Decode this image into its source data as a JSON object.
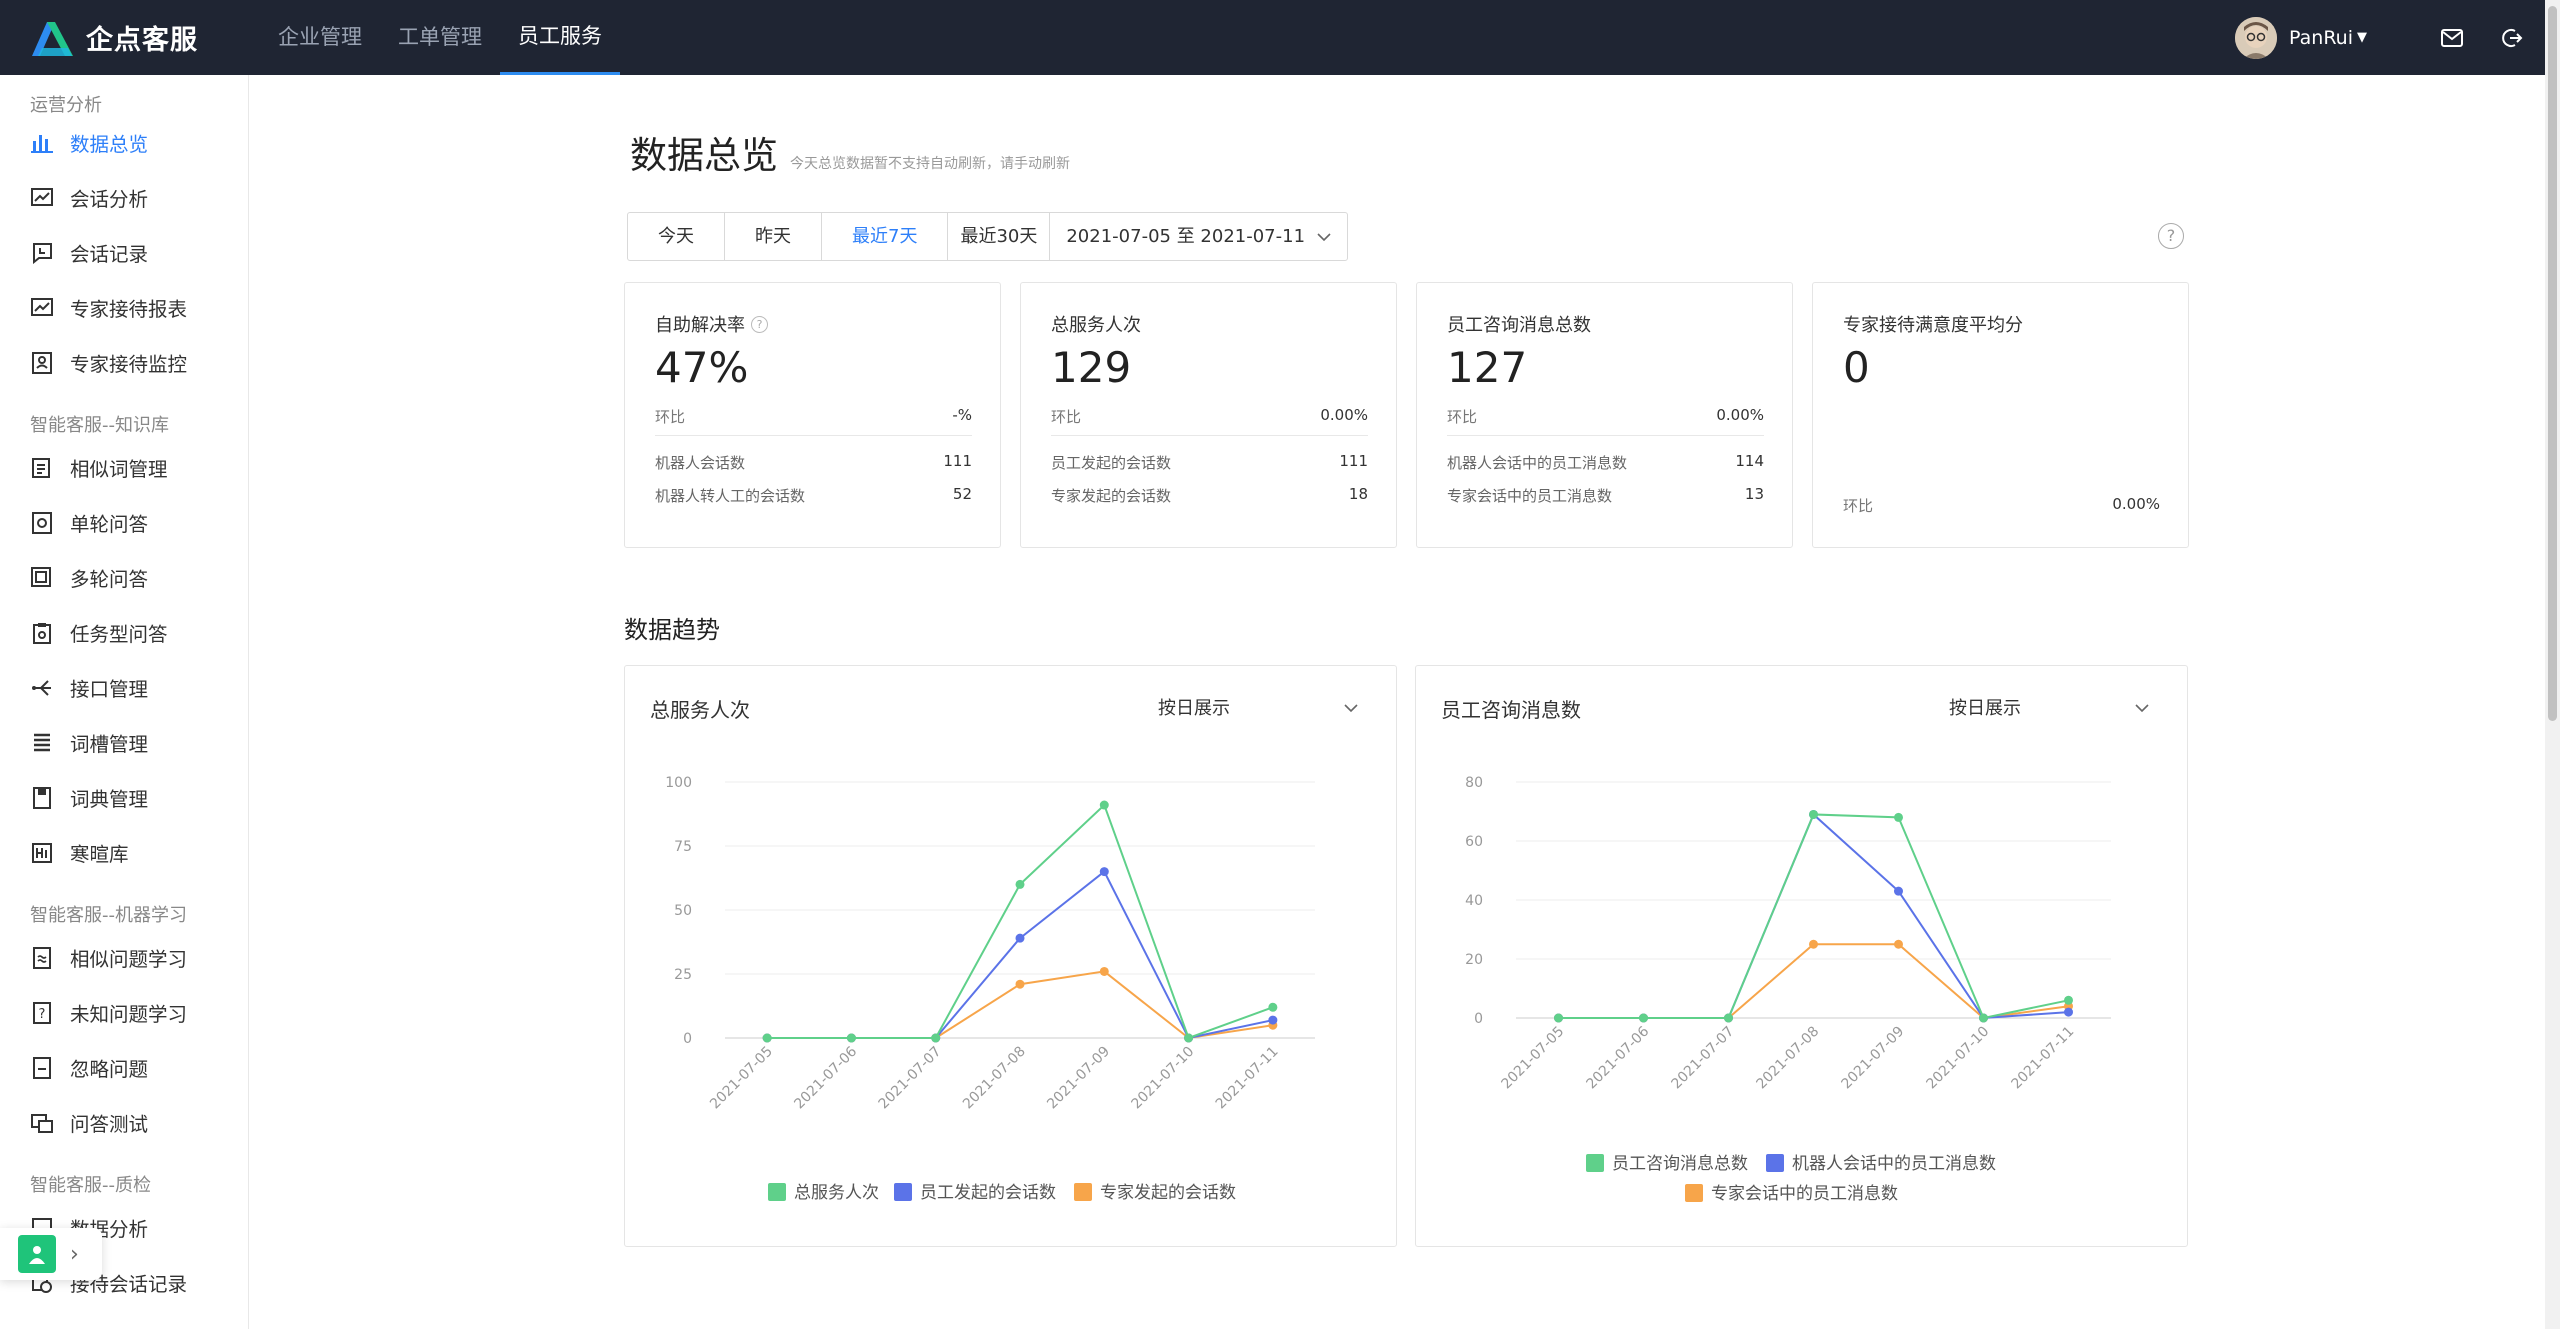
{
  "app": {
    "name": "企点客服"
  },
  "topnav": [
    {
      "label": "企业管理",
      "active": false
    },
    {
      "label": "工单管理",
      "active": false
    },
    {
      "label": "员工服务",
      "active": true
    }
  ],
  "user": {
    "name": "PanRui"
  },
  "sidebar": {
    "groups": [
      {
        "title": "运营分析",
        "items": [
          {
            "label": "数据总览",
            "icon": "bar-chart-icon",
            "active": true
          },
          {
            "label": "会话分析",
            "icon": "trend-chart-icon"
          },
          {
            "label": "会话记录",
            "icon": "chat-record-icon"
          },
          {
            "label": "专家接待报表",
            "icon": "report-chart-icon"
          },
          {
            "label": "专家接待监控",
            "icon": "monitor-person-icon"
          }
        ]
      },
      {
        "title": "智能客服--知识库",
        "items": [
          {
            "label": "相似词管理",
            "icon": "similar-words-icon"
          },
          {
            "label": "单轮问答",
            "icon": "single-qa-icon"
          },
          {
            "label": "多轮问答",
            "icon": "multi-qa-icon"
          },
          {
            "label": "任务型问答",
            "icon": "task-qa-icon"
          },
          {
            "label": "接口管理",
            "icon": "api-branch-icon"
          },
          {
            "label": "词槽管理",
            "icon": "slot-list-icon"
          },
          {
            "label": "词典管理",
            "icon": "dictionary-icon"
          },
          {
            "label": "寒暄库",
            "icon": "greeting-hi-icon"
          }
        ]
      },
      {
        "title": "智能客服--机器学习",
        "items": [
          {
            "label": "相似问题学习",
            "icon": "similar-question-icon"
          },
          {
            "label": "未知问题学习",
            "icon": "unknown-question-icon"
          },
          {
            "label": "忽略问题",
            "icon": "ignore-icon"
          },
          {
            "label": "问答测试",
            "icon": "qa-test-icon"
          }
        ]
      },
      {
        "title": "智能客服--质检",
        "items": [
          {
            "label": "数据分析",
            "icon": "data-analysis-icon"
          },
          {
            "label": "接待会话记录",
            "icon": "session-record-icon"
          }
        ]
      }
    ]
  },
  "page": {
    "title": "数据总览",
    "subtitle": "今天总览数据暂不支持自动刷新，请手动刷新"
  },
  "range": {
    "buttons": [
      {
        "label": "今天",
        "active": false
      },
      {
        "label": "昨天",
        "active": false
      },
      {
        "label": "最近7天",
        "active": true
      },
      {
        "label": "最近30天",
        "active": false
      }
    ],
    "date_range": "2021-07-05 至 2021-07-11"
  },
  "cards": [
    {
      "label": "自助解决率",
      "value": "47%",
      "ratio_label": "环比",
      "ratio": "-%",
      "rows": [
        {
          "k": "机器人会话数",
          "v": "111"
        },
        {
          "k": "机器人转人工的会话数",
          "v": "52"
        }
      ]
    },
    {
      "label": "总服务人次",
      "value": "129",
      "ratio_label": "环比",
      "ratio": "0.00%",
      "rows": [
        {
          "k": "员工发起的会话数",
          "v": "111"
        },
        {
          "k": "专家发起的会话数",
          "v": "18"
        }
      ]
    },
    {
      "label": "员工咨询消息总数",
      "value": "127",
      "ratio_label": "环比",
      "ratio": "0.00%",
      "rows": [
        {
          "k": "机器人会话中的员工消息数",
          "v": "114"
        },
        {
          "k": "专家会话中的员工消息数",
          "v": "13"
        }
      ]
    },
    {
      "label": "专家接待满意度平均分",
      "value": "0",
      "ratio_label": "环比",
      "ratio": "0.00%",
      "rows": []
    }
  ],
  "trend": {
    "title": "数据趋势",
    "select_label": "按日展示"
  },
  "chart_data": [
    {
      "type": "line",
      "title": "总服务人次",
      "x": [
        "2021-07-05",
        "2021-07-06",
        "2021-07-07",
        "2021-07-08",
        "2021-07-09",
        "2021-07-10",
        "2021-07-11"
      ],
      "ylim": [
        0,
        100
      ],
      "yticks": [
        0,
        25,
        50,
        75,
        100
      ],
      "grid": true,
      "legend": "bottom",
      "series": [
        {
          "name": "总服务人次",
          "color": "#5fd08a",
          "values": [
            0,
            0,
            0,
            60,
            91,
            0,
            12
          ]
        },
        {
          "name": "员工发起的会话数",
          "color": "#5b73e8",
          "values": [
            0,
            0,
            0,
            39,
            65,
            0,
            7
          ]
        },
        {
          "name": "专家发起的会话数",
          "color": "#f7a54a",
          "values": [
            0,
            0,
            0,
            21,
            26,
            0,
            5
          ]
        }
      ]
    },
    {
      "type": "line",
      "title": "员工咨询消息数",
      "x": [
        "2021-07-05",
        "2021-07-06",
        "2021-07-07",
        "2021-07-08",
        "2021-07-09",
        "2021-07-10",
        "2021-07-11"
      ],
      "ylim": [
        0,
        80
      ],
      "yticks": [
        0,
        20,
        40,
        60,
        80
      ],
      "grid": true,
      "legend": "bottom",
      "series": [
        {
          "name": "员工咨询消息总数",
          "color": "#5fd08a",
          "values": [
            0,
            0,
            0,
            69,
            68,
            0,
            6
          ]
        },
        {
          "name": "机器人会话中的员工消息数",
          "color": "#5b73e8",
          "values": [
            0,
            0,
            0,
            69,
            43,
            0,
            2
          ]
        },
        {
          "name": "专家会话中的员工消息数",
          "color": "#f7a54a",
          "values": [
            0,
            0,
            0,
            25,
            25,
            0,
            4
          ]
        }
      ]
    }
  ]
}
